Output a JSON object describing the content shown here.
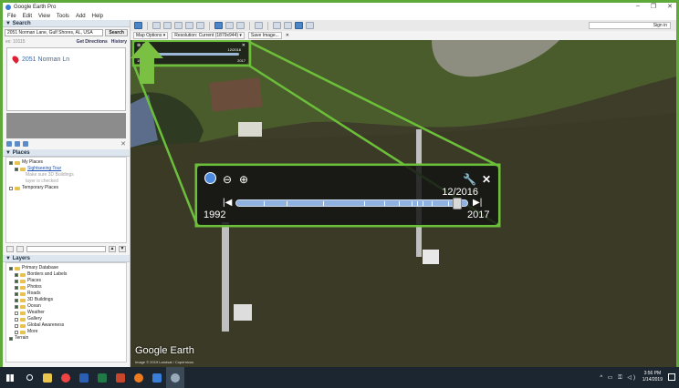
{
  "app": {
    "title": "Google Earth Pro",
    "window_controls": [
      "–",
      "❐",
      "✕"
    ]
  },
  "menu": [
    "File",
    "Edit",
    "View",
    "Tools",
    "Add",
    "Help"
  ],
  "toolbar": {
    "signin_label": "Sign in"
  },
  "optbar": {
    "map_options": "Map Options ▾",
    "resolution": "Resolution: Current (1879x944) ▾",
    "save_image": "Save Image...",
    "close": "✕"
  },
  "search": {
    "section_title": "▼ Search",
    "value": "2051 Norman Lane, Gulf Shores, AL, USA",
    "button_label": "Search",
    "history_hint": "ex: 10115",
    "get_directions": "Get Directions",
    "history": "History",
    "result": "2051 Norman Ln"
  },
  "places": {
    "section_title": "▼ Places",
    "items": [
      {
        "label": "My Places",
        "style": "normal"
      },
      {
        "label": "Sightseeing Tour",
        "style": "link"
      },
      {
        "label": "Make sure 3D Buildings",
        "style": "grey"
      },
      {
        "label": "layer is checked",
        "style": "grey"
      },
      {
        "label": "Temporary Places",
        "style": "normal"
      }
    ]
  },
  "layers": {
    "section_title": "▼ Layers",
    "items": [
      "Primary Database",
      "Borders and Labels",
      "Places",
      "Photos",
      "Roads",
      "3D Buildings",
      "Ocean",
      "Weather",
      "Gallery",
      "Global Awareness",
      "More",
      "Terrain"
    ]
  },
  "map": {
    "logo": "Google Earth",
    "imagery_note": "Image © 2019 Landsat / Copernicus",
    "mini_date": "12/2016",
    "mini_start": "1992",
    "mini_end": "2017"
  },
  "historical_imagery": {
    "current_date": "12/2016",
    "start_year": "1992",
    "end_year": "2017",
    "position": 0.955,
    "zoom_out_icon": "zoom-out-icon",
    "zoom_in_icon": "zoom-in-icon",
    "wrench_icon": "wrench-icon",
    "close_icon": "close-icon"
  },
  "taskbar": {
    "time": "3:56 PM",
    "date": "1/14/2019"
  },
  "colors": {
    "border_green": "#6cbf3a",
    "arrow_green": "#7ac143",
    "slider_track": "#8fb2e0",
    "taskbar": "#1c2630"
  }
}
